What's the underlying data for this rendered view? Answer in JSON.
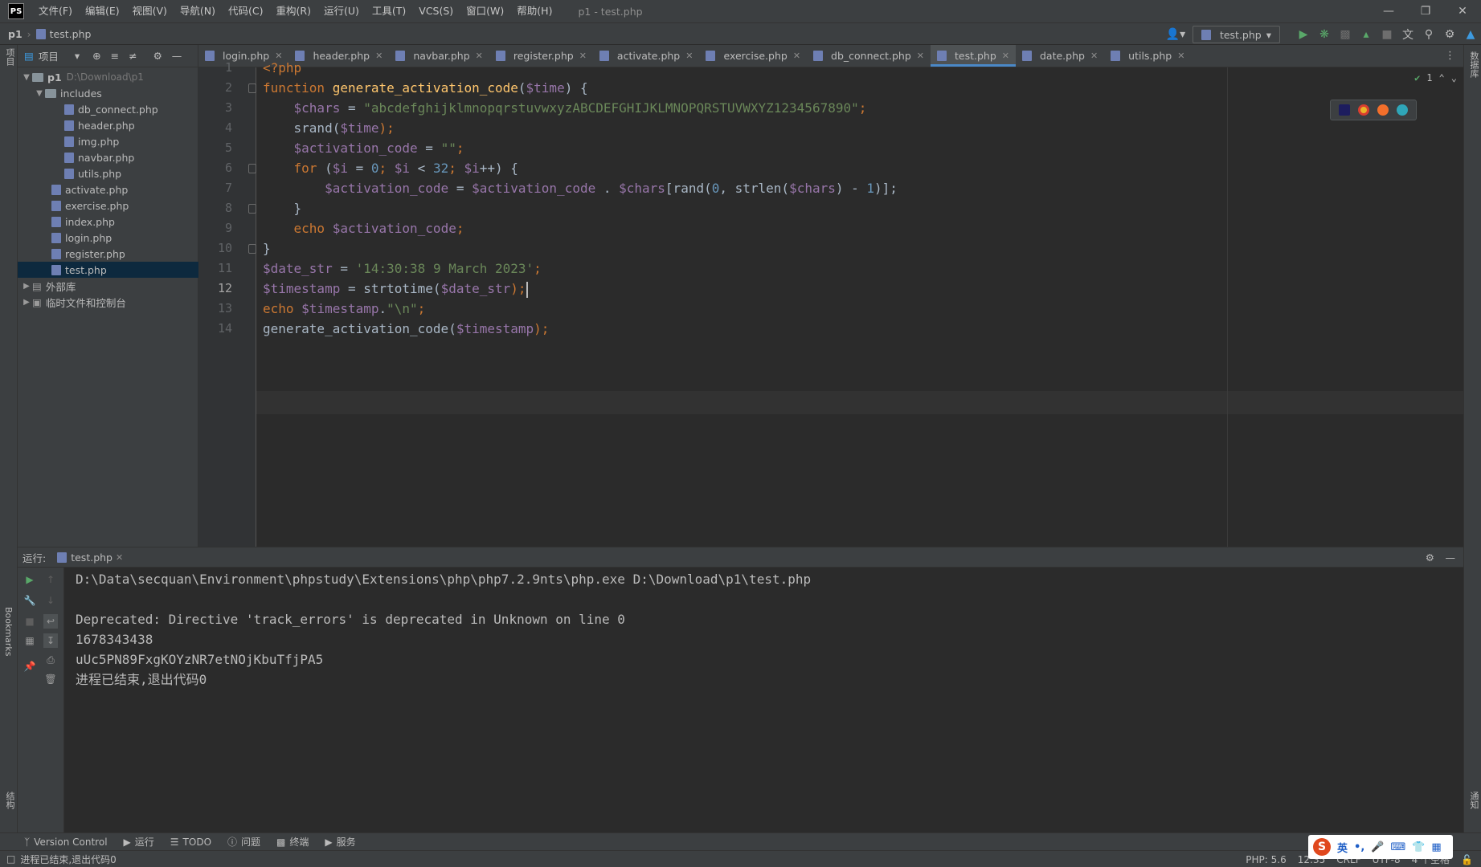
{
  "app": {
    "logo": "PS",
    "window_title": "p1 - test.php"
  },
  "menu": [
    "文件(F)",
    "编辑(E)",
    "视图(V)",
    "导航(N)",
    "代码(C)",
    "重构(R)",
    "运行(U)",
    "工具(T)",
    "VCS(S)",
    "窗口(W)",
    "帮助(H)"
  ],
  "breadcrumb": {
    "project": "p1",
    "file": "test.php"
  },
  "run_config": {
    "label": "test.php"
  },
  "left_stripe": {
    "project": "项目",
    "bookmarks": "Bookmarks",
    "structure": "结构"
  },
  "right_stripe": {
    "database": "数据库",
    "notifications": "通知"
  },
  "project_panel": {
    "title": "项目",
    "tree": [
      {
        "label": "p1",
        "hint": "D:\\Download\\p1"
      },
      {
        "label": "includes"
      },
      {
        "label": "db_connect.php"
      },
      {
        "label": "header.php"
      },
      {
        "label": "img.php"
      },
      {
        "label": "navbar.php"
      },
      {
        "label": "utils.php"
      },
      {
        "label": "activate.php"
      },
      {
        "label": "exercise.php"
      },
      {
        "label": "index.php"
      },
      {
        "label": "login.php"
      },
      {
        "label": "register.php"
      },
      {
        "label": "test.php"
      },
      {
        "label": "外部库"
      },
      {
        "label": "临时文件和控制台"
      }
    ]
  },
  "tabs": [
    "login.php",
    "header.php",
    "navbar.php",
    "register.php",
    "activate.php",
    "exercise.php",
    "db_connect.php",
    "test.php",
    "date.php",
    "utils.php"
  ],
  "editor": {
    "inspection_count": "1",
    "line_numbers": [
      "1",
      "2",
      "3",
      "4",
      "5",
      "6",
      "7",
      "8",
      "9",
      "10",
      "11",
      "12",
      "13",
      "14"
    ],
    "code": {
      "l1": "<?php",
      "l2_kw": "function",
      "l2_fn": "generate_activation_code",
      "l2_open": "(",
      "l2_var": "$time",
      "l2_close": ") {",
      "l3_var": "$chars",
      "l3_eq": " = ",
      "l3_str": "\"abcdefghijklmnopqrstuvwxyzABCDEFGHIJKLMNOPQRSTUVWXYZ1234567890\"",
      "l3_semi": ";",
      "l4_fn": "srand(",
      "l4_var": "$time",
      "l4_end": ");",
      "l5_var": "$activation_code",
      "l5_eq": " = ",
      "l5_str": "\"\"",
      "l5_semi": ";",
      "l6_kw": "for",
      "l6_a": " (",
      "l6_v1": "$i",
      "l6_b": " = ",
      "l6_n0": "0",
      "l6_c": "; ",
      "l6_v2": "$i",
      "l6_d": " < ",
      "l6_n32": "32",
      "l6_e": "; ",
      "l6_v3": "$i",
      "l6_f": "++) {",
      "l7_v1": "$activation_code",
      "l7_a": " = ",
      "l7_v2": "$activation_code",
      "l7_b": " . ",
      "l7_v3": "$chars",
      "l7_c": "[rand(",
      "l7_n0": "0",
      "l7_d": ", strlen(",
      "l7_v4": "$chars",
      "l7_e": ") - ",
      "l7_n1": "1",
      "l7_f": ")];",
      "l8": "}",
      "l9_kw": "echo",
      "l9_var": "$activation_code",
      "l9_semi": ";",
      "l10": "}",
      "l11_var": "$date_str",
      "l11_eq": " = ",
      "l11_str": "'14:30:38 9 March 2023'",
      "l11_semi": ";",
      "l12_var": "$timestamp",
      "l12_a": " = strtotime(",
      "l12_v2": "$date_str",
      "l12_b": ");",
      "l13_kw": "echo",
      "l13_var": "$timestamp",
      "l13_dot": ".",
      "l13_str": "\"\\n\"",
      "l13_semi": ";",
      "l14_a": "generate_activation_code(",
      "l14_var": "$timestamp",
      "l14_b": ");"
    }
  },
  "run_panel": {
    "label": "运行:",
    "tab": "test.php",
    "console": [
      "D:\\Data\\secquan\\Environment\\phpstudy\\Extensions\\php\\php7.2.9nts\\php.exe D:\\Download\\p1\\test.php",
      "",
      "Deprecated: Directive 'track_errors' is deprecated in Unknown on line 0",
      "1678343438",
      "uUc5PN89FxgKOYzNR7etNOjKbuTfjPA5",
      "进程已结束,退出代码0"
    ]
  },
  "bottom_toolbar": [
    "Version Control",
    "运行",
    "TODO",
    "问题",
    "终端",
    "服务"
  ],
  "statusbar": {
    "message": "进程已结束,退出代码0",
    "php": "PHP: 5.6",
    "position": "12:35",
    "line_sep": "CRLF",
    "encoding": "UTF-8",
    "indent": "4 个空格"
  },
  "ime": {
    "mode": "英"
  }
}
